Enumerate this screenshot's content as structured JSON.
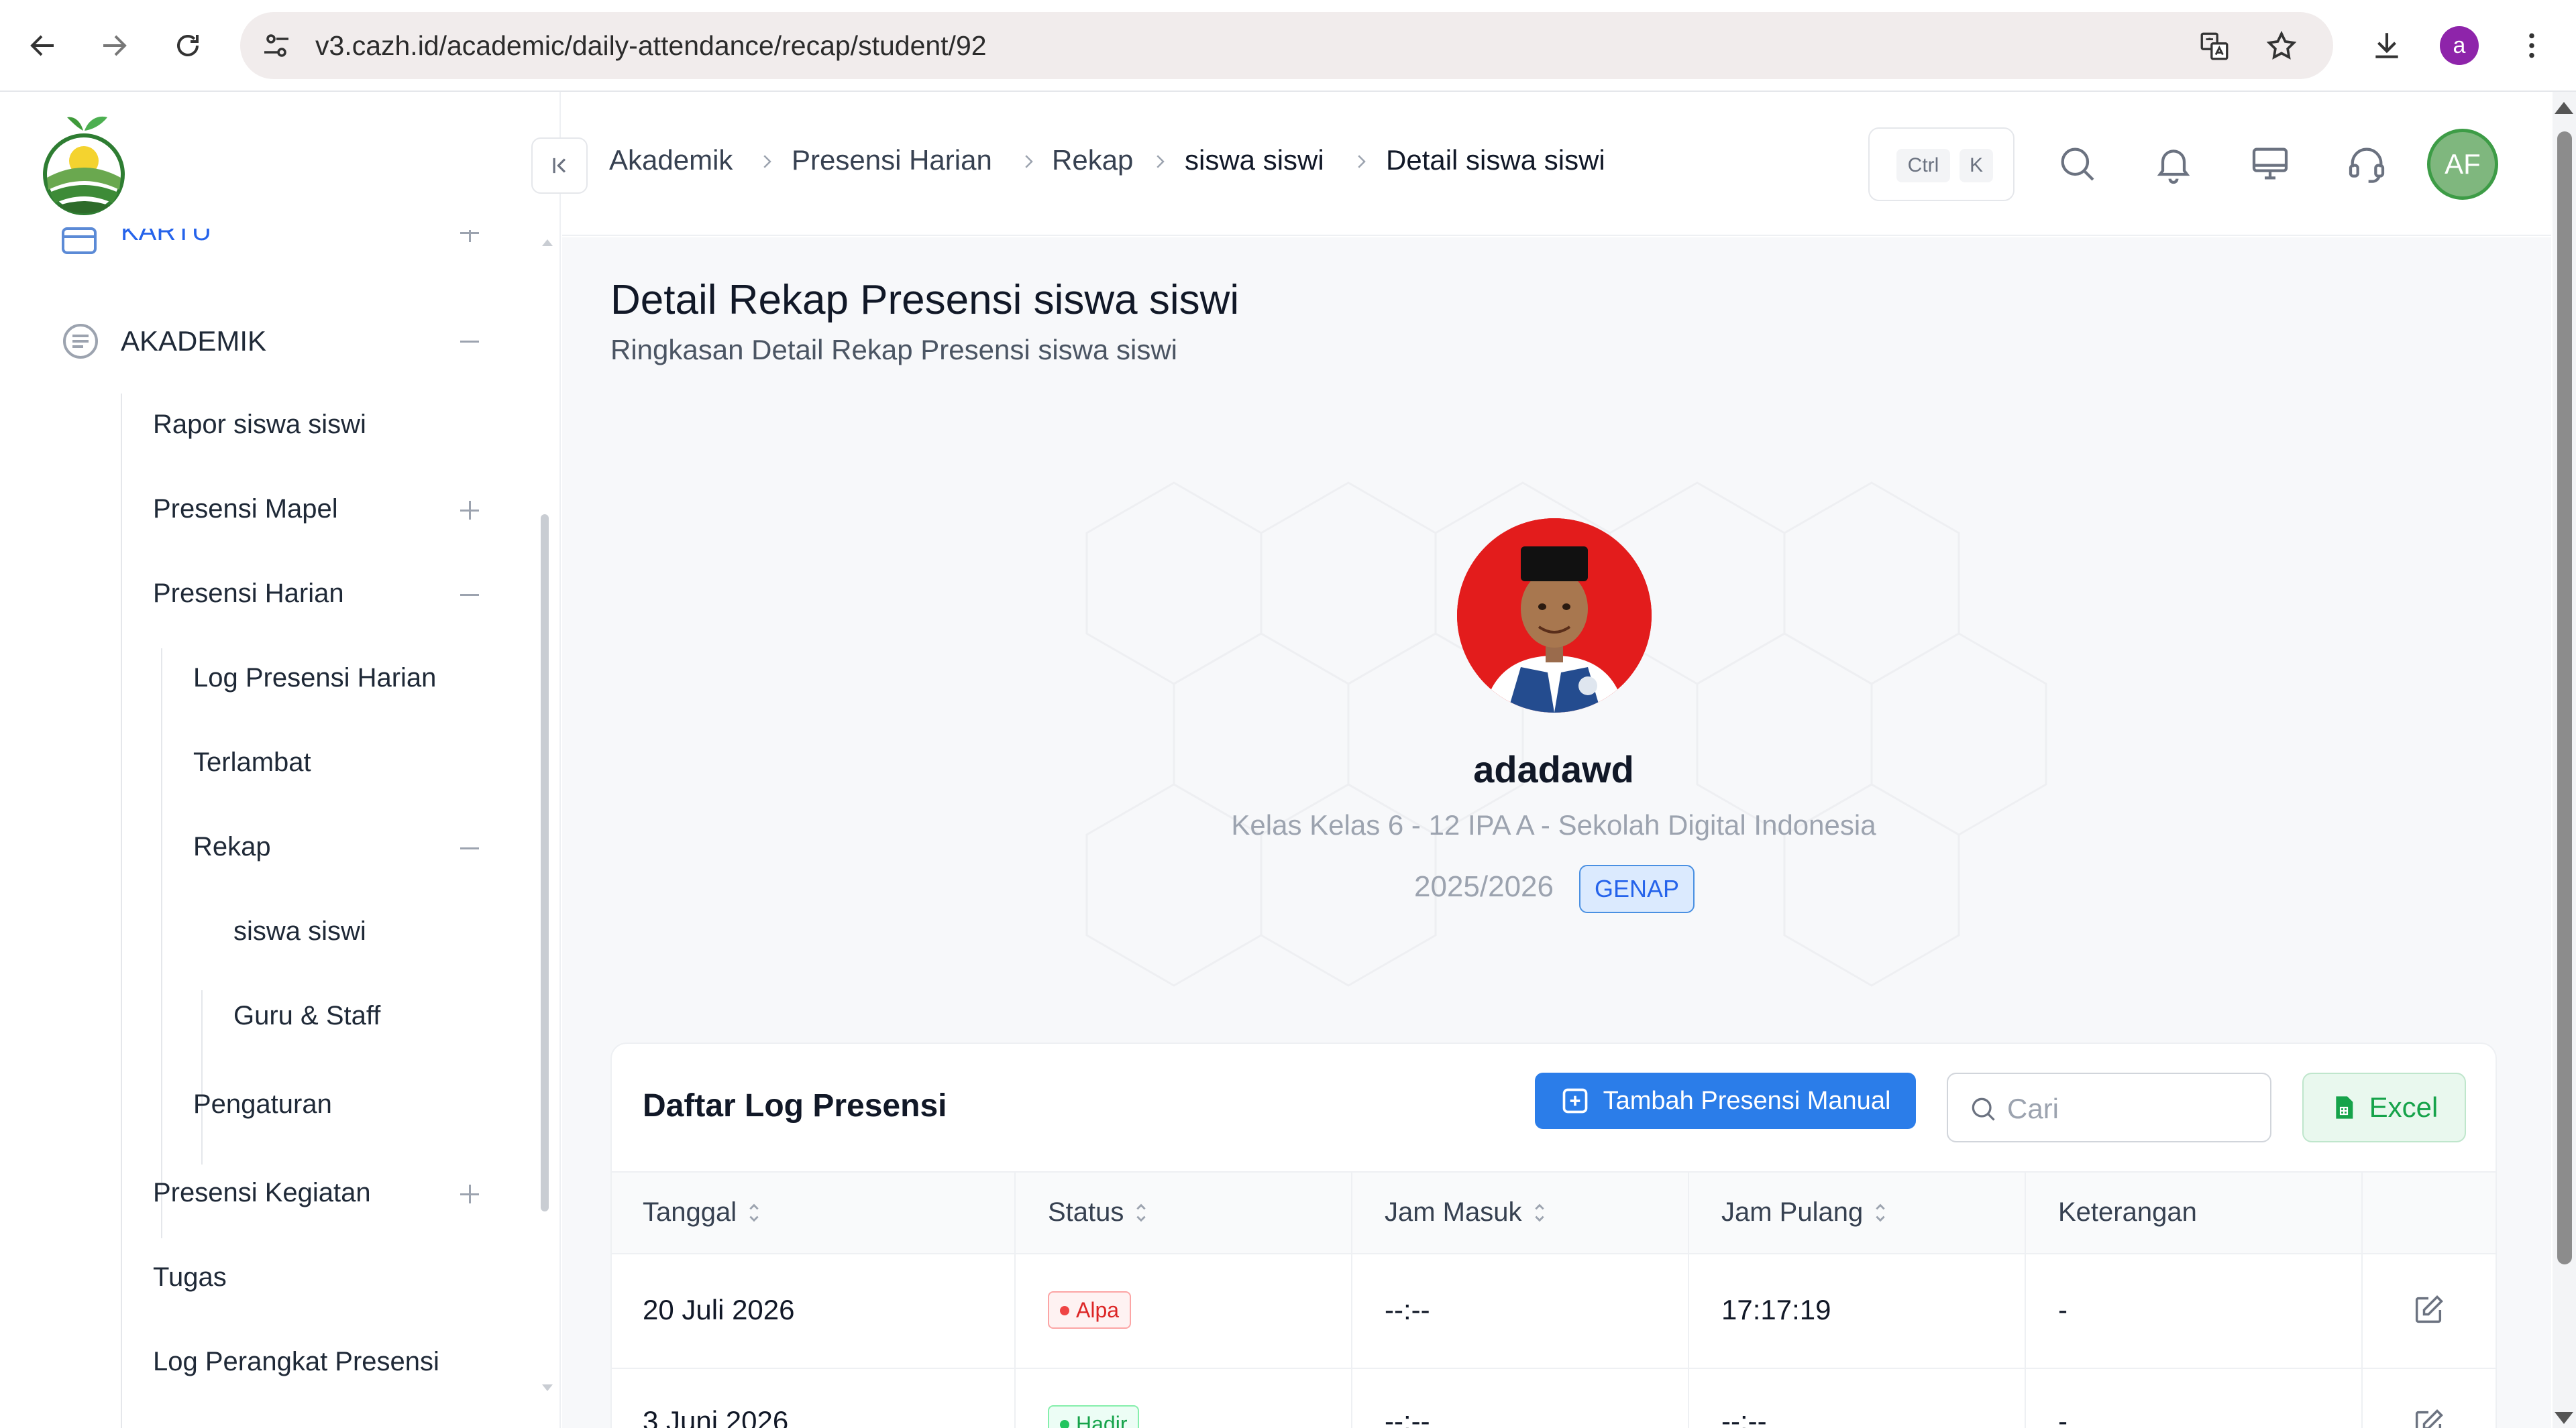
{
  "browser": {
    "url": "v3.cazh.id/academic/daily-attendance/recap/student/92",
    "profile_initial": "a"
  },
  "sidebar": {
    "partial_item": "KARTU",
    "section": "AKADEMIK",
    "items": [
      {
        "label": "Rapor siswa siswi"
      },
      {
        "label": "Presensi Mapel"
      },
      {
        "label": "Presensi Harian"
      },
      {
        "label": "Log Presensi Harian"
      },
      {
        "label": "Terlambat"
      },
      {
        "label": "Rekap"
      },
      {
        "label": "siswa siswi"
      },
      {
        "label": "Guru & Staff"
      },
      {
        "label": "Pengaturan"
      },
      {
        "label": "Presensi Kegiatan"
      },
      {
        "label": "Tugas"
      },
      {
        "label": "Log Perangkat Presensi"
      }
    ]
  },
  "header": {
    "breadcrumb": [
      "Akademik",
      "Presensi Harian",
      "Rekap",
      "siswa siswi",
      "Detail siswa siswi"
    ],
    "shortcut_ctrl": "Ctrl",
    "shortcut_key": "K",
    "user_initials": "AF"
  },
  "page": {
    "title": "Detail Rekap Presensi siswa siswi",
    "subtitle": "Ringkasan Detail Rekap Presensi siswa siswi"
  },
  "student": {
    "name": "adadawd",
    "class_info": "Kelas Kelas 6 - 12 IPA A - Sekolah Digital Indonesia",
    "year": "2025/2026",
    "semester": "GENAP"
  },
  "log_card": {
    "title": "Daftar Log Presensi",
    "add_button": "Tambah Presensi Manual",
    "search_placeholder": "Cari",
    "excel_button": "Excel",
    "columns": [
      "Tanggal",
      "Status",
      "Jam Masuk",
      "Jam Pulang",
      "Keterangan"
    ],
    "rows": [
      {
        "date": "20 Juli 2026",
        "status": "Alpa",
        "in": "--:--",
        "out": "17:17:19",
        "note": "-"
      },
      {
        "date": "3 Juni 2026",
        "status": "Hadir",
        "in": "--:--",
        "out": "--:--",
        "note": "-"
      }
    ]
  },
  "colors": {
    "primary": "#2b7de9",
    "alpa": "#dc2626",
    "hadir": "#16a34a",
    "excel": "#16a34a",
    "avatar_ring": "#3d9c46"
  }
}
